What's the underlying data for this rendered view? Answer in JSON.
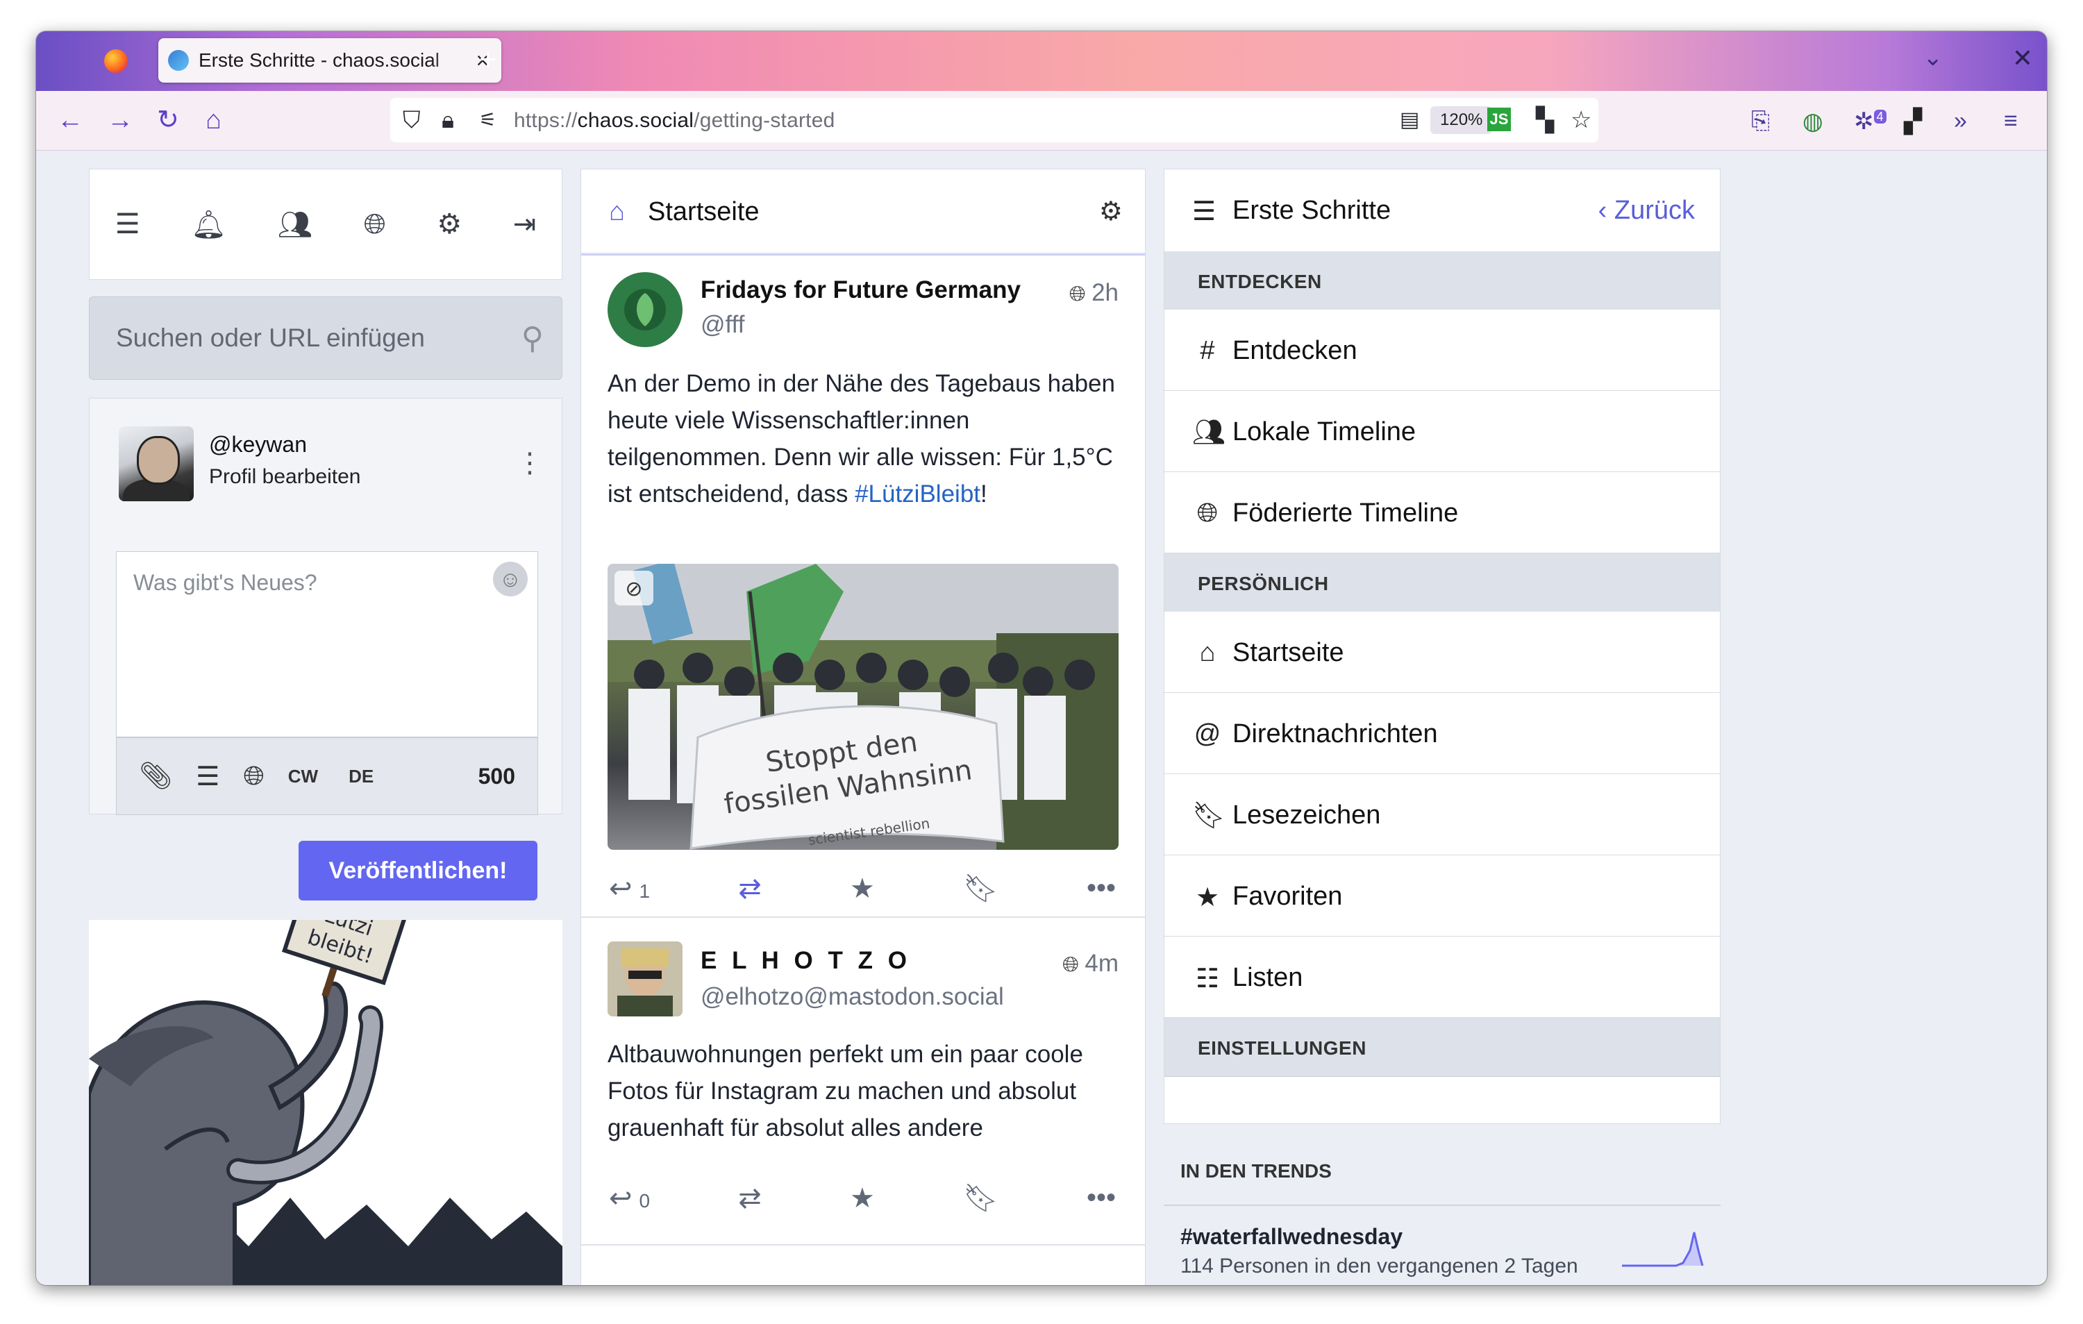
{
  "browser": {
    "tab_title": "Erste Schritte - chaos.social",
    "new_tab": "+",
    "url_prefix": "https://",
    "url_host": "chaos.social",
    "url_path": "/getting-started",
    "zoom": "120%",
    "js_badge": "JS",
    "ext_badge": "4"
  },
  "left": {
    "search_placeholder": "Suchen oder URL einfügen",
    "profile_handle": "@keywan",
    "profile_edit": "Profil bearbeiten",
    "compose_placeholder": "Was gibt's Neues?",
    "cw_label": "CW",
    "lang_label": "DE",
    "char_count": "500",
    "publish_label": "Veröffentlichen!",
    "sign_text_1": "Lützi",
    "sign_text_2": "bleibt!"
  },
  "center": {
    "column_title": "Startseite",
    "posts": [
      {
        "name": "Fridays for Future Germany",
        "handle": "@fff",
        "time": "2h",
        "text_before_tag": "An der Demo in der Nähe des Tagebaus haben heute viele Wissenschaftler:innen teilgenommen. Denn wir alle wissen: Für 1,5°C ist entscheidend, dass ",
        "hashtag": "#LütziBleibt",
        "text_after_tag": "!",
        "banner_text_1": "Stoppt den",
        "banner_text_2": "fossilen Wahnsinn",
        "banner_text_3": "scientist rebellion",
        "replies": "1"
      },
      {
        "name": "E L H O T Z O",
        "handle": "@elhotzo@mastodon.social",
        "time": "4m",
        "text": "Altbauwohnungen perfekt um ein paar coole Fotos für Instagram zu machen und absolut grauenhaft für absolut alles andere",
        "replies": "0"
      }
    ]
  },
  "right": {
    "title": "Erste Schritte",
    "back": "Zurück",
    "section_discover": "ENTDECKEN",
    "section_personal": "PERSÖNLICH",
    "section_settings": "EINSTELLUNGEN",
    "items": {
      "explore": "Entdecken",
      "local": "Lokale Timeline",
      "federated": "Föderierte Timeline",
      "home": "Startseite",
      "direct": "Direktnachrichten",
      "bookmarks": "Lesezeichen",
      "favourites": "Favoriten",
      "lists": "Listen"
    },
    "trends_heading": "IN DEN TRENDS",
    "trend_tag": "#waterfallwednesday",
    "trend_sub": "114 Personen in den vergangenen 2 Tagen"
  },
  "colors": {
    "accent": "#6366f1",
    "link": "#2563c4"
  }
}
